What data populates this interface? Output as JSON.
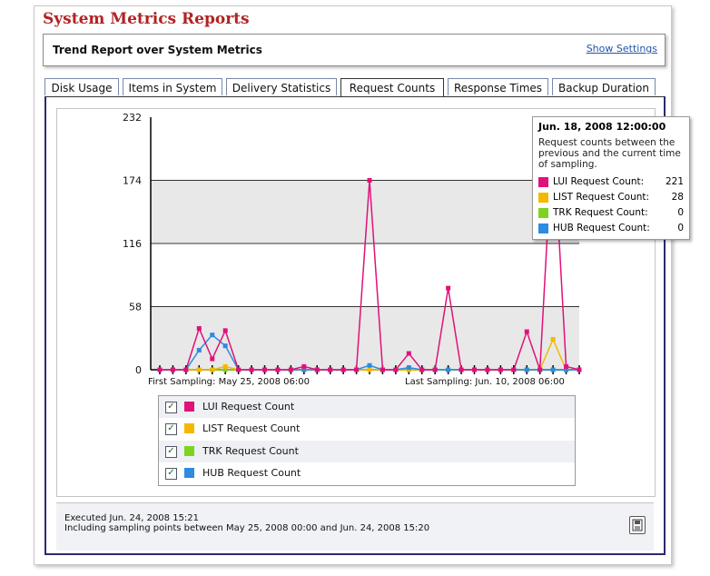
{
  "page_title": "System Metrics Reports",
  "report": {
    "title": "Trend Report over System Metrics",
    "show_settings": "Show Settings"
  },
  "tabs": [
    {
      "label": "Disk Usage"
    },
    {
      "label": "Items in System"
    },
    {
      "label": "Delivery Statistics"
    },
    {
      "label": "Request Counts",
      "active": true
    },
    {
      "label": "Response Times"
    },
    {
      "label": "Backup Duration"
    }
  ],
  "chart_data": {
    "type": "line",
    "y_ticks": [
      "0",
      "58",
      "116",
      "174",
      "232"
    ],
    "ylim": [
      0,
      232
    ],
    "first_sampling": "First Sampling: May 25, 2008 06:00",
    "last_sampling": "Last Sampling: Jun. 10, 2008 06:00",
    "x": [
      0,
      1,
      2,
      3,
      4,
      5,
      6,
      7,
      8,
      9,
      10,
      11,
      12,
      13,
      14,
      15,
      16,
      17,
      18,
      19,
      20,
      21,
      22,
      23,
      24,
      25,
      26,
      27,
      28,
      29,
      30,
      31,
      32
    ],
    "series": [
      {
        "name": "LUI Request Count",
        "color": "#e0117a",
        "values": [
          0,
          0,
          0,
          38,
          10,
          36,
          0,
          0,
          0,
          0,
          0,
          3,
          0,
          0,
          0,
          0,
          174,
          0,
          0,
          15,
          0,
          0,
          75,
          0,
          0,
          0,
          0,
          0,
          35,
          0,
          221,
          3,
          0
        ]
      },
      {
        "name": "LIST Request Count",
        "color": "#f5b800",
        "values": [
          0,
          0,
          0,
          0,
          0,
          3,
          0,
          0,
          0,
          0,
          0,
          0,
          0,
          0,
          0,
          0,
          0,
          0,
          0,
          0,
          0,
          0,
          0,
          0,
          0,
          0,
          0,
          0,
          0,
          0,
          28,
          0,
          0
        ]
      },
      {
        "name": "TRK Request Count",
        "color": "#7ed321",
        "values": [
          0,
          0,
          0,
          0,
          0,
          0,
          0,
          0,
          0,
          0,
          0,
          0,
          0,
          0,
          0,
          0,
          0,
          0,
          0,
          0,
          0,
          0,
          0,
          0,
          0,
          0,
          0,
          0,
          0,
          0,
          0,
          0,
          0
        ]
      },
      {
        "name": "HUB Request Count",
        "color": "#2d8be0",
        "values": [
          0,
          0,
          0,
          18,
          32,
          22,
          0,
          0,
          0,
          0,
          0,
          0,
          0,
          0,
          0,
          0,
          4,
          0,
          0,
          2,
          0,
          0,
          0,
          0,
          0,
          0,
          0,
          0,
          0,
          0,
          0,
          0,
          0
        ]
      }
    ]
  },
  "tooltip": {
    "title": "Jun. 18, 2008 12:00:00",
    "desc": "Request counts between the previous and the current time of sampling.",
    "rows": [
      {
        "label": "LUI Request Count:",
        "value": "221",
        "color": "#e0117a"
      },
      {
        "label": "LIST Request Count:",
        "value": "28",
        "color": "#f5b800"
      },
      {
        "label": "TRK Request Count:",
        "value": "0",
        "color": "#7ed321"
      },
      {
        "label": "HUB Request Count:",
        "value": "0",
        "color": "#2d8be0"
      }
    ]
  },
  "legend": [
    {
      "label": "LUI Request Count",
      "color": "#e0117a",
      "checked": true
    },
    {
      "label": "LIST Request Count",
      "color": "#f5b800",
      "checked": true
    },
    {
      "label": "TRK Request Count",
      "color": "#7ed321",
      "checked": true
    },
    {
      "label": "HUB Request Count",
      "color": "#2d8be0",
      "checked": true
    }
  ],
  "footer": {
    "executed": "Executed Jun. 24, 2008 15:21",
    "range": "Including sampling points between May 25, 2008 00:00 and Jun. 24, 2008 15:20"
  },
  "icons": {
    "export": "save-export-icon",
    "checkbox": "checkmark-icon"
  }
}
